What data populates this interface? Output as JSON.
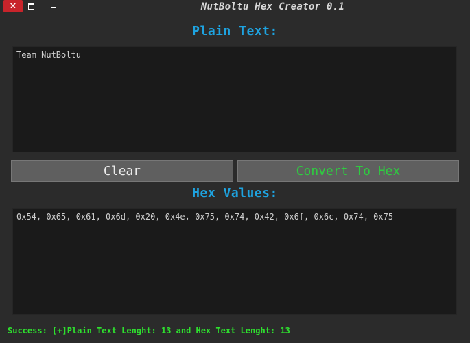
{
  "window": {
    "title": "NutBoltu Hex Creator 0.1",
    "controls": {
      "close_glyph": "✕"
    }
  },
  "plain": {
    "label": "Plain Text:",
    "value": "Team NutBoltu"
  },
  "buttons": {
    "clear_label": "Clear",
    "convert_label": "Convert To Hex"
  },
  "hex": {
    "label": "Hex Values:",
    "value": "0x54, 0x65, 0x61, 0x6d, 0x20, 0x4e, 0x75, 0x74, 0x42, 0x6f, 0x6c, 0x74, 0x75"
  },
  "status": {
    "text": "Success: [+]Plain Text Lenght: 13 and Hex Text Lenght: 13"
  },
  "colors": {
    "background": "#2b2b2b",
    "label_blue": "#1ea3e0",
    "textbox_bg": "#1a1a1a",
    "button_bg": "#5f5f5f",
    "convert_green": "#2ecc40",
    "status_green": "#2ee02e",
    "close_red": "#c8242b"
  }
}
